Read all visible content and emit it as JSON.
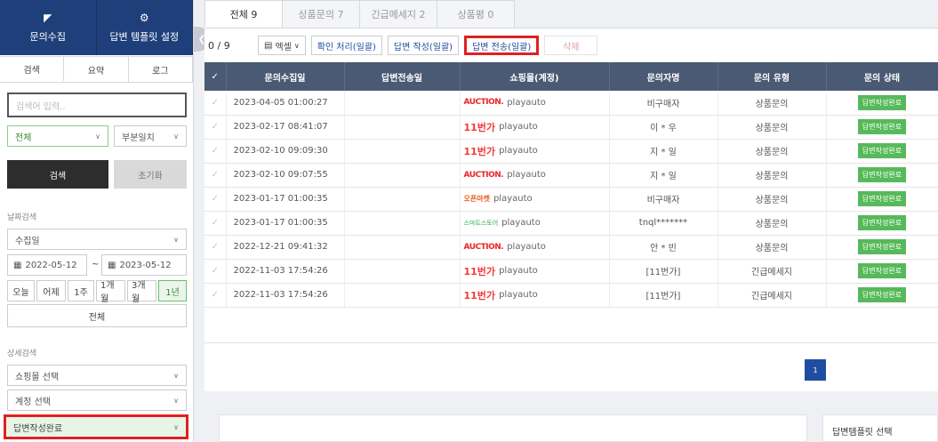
{
  "sidebar": {
    "top_buttons": [
      {
        "label": "문의수집",
        "icon": "collect-icon"
      },
      {
        "label": "답변 템플릿 설정",
        "icon": "gear-icon"
      }
    ],
    "subtabs": [
      "검색",
      "요약",
      "로그"
    ],
    "search": {
      "placeholder": "검색어 입력.."
    },
    "scope_select": "전체",
    "match_select": "부분일치",
    "search_button": "검색",
    "reset_button": "초기화",
    "date_section_label": "날짜검색",
    "date_type_select": "수집일",
    "date_from": "2022-05-12",
    "date_to": "2023-05-12",
    "date_separator": "~",
    "periods": [
      "오늘",
      "어제",
      "1주",
      "1개월",
      "3개월",
      "1년"
    ],
    "all_button": "전체",
    "detail_section_label": "상세검색",
    "mall_select": "쇼핑몰 선택",
    "account_select": "계정 선택",
    "status_select": "답변작성완료"
  },
  "main": {
    "tabs": [
      "전체 9",
      "상품문의 7",
      "긴급메세지 2",
      "상품평 0"
    ],
    "count": "0 / 9",
    "toolbar": {
      "excel": "엑셀",
      "confirm": "확인 처리(일괄)",
      "write": "답변 작성(일괄)",
      "send": "답변 전송(일괄)",
      "delete": "삭제"
    },
    "columns": [
      "문의수집일",
      "답변전송일",
      "쇼핑몰(계정)",
      "문의자명",
      "문의 유형",
      "문의 상태"
    ],
    "rows": [
      {
        "collected": "2023-04-05 01:00:27",
        "sent": "",
        "mall_logo": "AUCTION.",
        "mall_type": "auction",
        "account": "playauto",
        "name": "비구매자",
        "type": "상품문의",
        "status": "답변작성완료"
      },
      {
        "collected": "2023-02-17 08:41:07",
        "sent": "",
        "mall_logo": "11번가",
        "mall_type": "11st",
        "account": "playauto",
        "name": "이 * 우",
        "type": "상품문의",
        "status": "답변작성완료"
      },
      {
        "collected": "2023-02-10 09:09:30",
        "sent": "",
        "mall_logo": "11번가",
        "mall_type": "11st",
        "account": "playauto",
        "name": "지 * 일",
        "type": "상품문의",
        "status": "답변작성완료"
      },
      {
        "collected": "2023-02-10 09:07:55",
        "sent": "",
        "mall_logo": "AUCTION.",
        "mall_type": "auction",
        "account": "playauto",
        "name": "지 * 일",
        "type": "상품문의",
        "status": "답변작성완료"
      },
      {
        "collected": "2023-01-17 01:00:35",
        "sent": "",
        "mall_logo": "오픈마켓",
        "mall_type": "open",
        "account": "playauto",
        "name": "비구매자",
        "type": "상품문의",
        "status": "답변작성완료"
      },
      {
        "collected": "2023-01-17 01:00:35",
        "sent": "",
        "mall_logo": "스마트스토어",
        "mall_type": "smart",
        "account": "playauto",
        "name": "tnql*******",
        "type": "상품문의",
        "status": "답변작성완료"
      },
      {
        "collected": "2022-12-21 09:41:32",
        "sent": "",
        "mall_logo": "AUCTION.",
        "mall_type": "auction",
        "account": "playauto",
        "name": "안 * 빈",
        "type": "상품문의",
        "status": "답변작성완료"
      },
      {
        "collected": "2022-11-03 17:54:26",
        "sent": "",
        "mall_logo": "11번가",
        "mall_type": "11st",
        "account": "playauto",
        "name": "[11번가]",
        "type": "긴급메세지",
        "status": "답변작성완료"
      },
      {
        "collected": "2022-11-03 17:54:26",
        "sent": "",
        "mall_logo": "11번가",
        "mall_type": "11st",
        "account": "playauto",
        "name": "[11번가]",
        "type": "긴급메세지",
        "status": "답변작성완료"
      }
    ],
    "page": "1"
  },
  "bottom": {
    "template_select_label": "답변템플릿 선택"
  }
}
